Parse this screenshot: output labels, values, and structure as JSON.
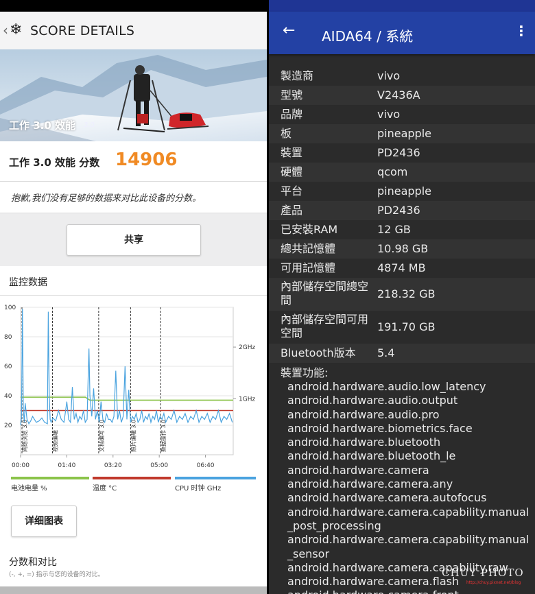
{
  "left": {
    "header": {
      "title": "SCORE DETAILS"
    },
    "hero": {
      "caption": "工作 3.0 效能",
      "version": "3.0"
    },
    "score": {
      "label": "工作 3.0 效能 分数",
      "value": "14906"
    },
    "notice": "抱歉,我们没有足够的数据来对比此设备的分数。",
    "share_label": "共享",
    "monitor": {
      "title": "监控数据",
      "legend": [
        {
          "label": "电池电量 %",
          "color": "#8bc34a"
        },
        {
          "label": "温度 °C",
          "color": "#c0392b"
        },
        {
          "label": "CPU 时钟 GHz",
          "color": "#4aa3df"
        }
      ]
    },
    "detail_label": "详细图表",
    "compare": {
      "title": "分数和对比",
      "subtitle": "(-, +, =) 指示与您的设备的对比。"
    }
  },
  "chart_data": {
    "type": "line",
    "y_left_ticks": [
      "100",
      "80",
      "60",
      "40",
      "20"
    ],
    "y_right_ticks": [
      "2GHz",
      "1GHz"
    ],
    "x_ticks": [
      "00:00",
      "01:40",
      "03:20",
      "05:00",
      "06:40"
    ],
    "sections": [
      "网络浏览 3.0",
      "视频编辑",
      "文档编写 3.0",
      "照片编辑 3.0",
      "数据操作 3.0"
    ],
    "xlim": [
      0,
      460
    ],
    "ylim": [
      0,
      100
    ],
    "series": [
      {
        "name": "电池电量 %",
        "color": "#8bc34a",
        "x": [
          0,
          100,
          140,
          150,
          460
        ],
        "values": [
          39,
          39,
          39,
          37,
          37
        ]
      },
      {
        "name": "温度 °C",
        "color": "#c0392b",
        "x": [
          0,
          460
        ],
        "values": [
          30,
          30
        ]
      },
      {
        "name": "CPU 时钟 GHz",
        "color": "#4aa3df",
        "x": [
          0,
          2,
          4,
          6,
          8,
          10,
          14,
          18,
          22,
          26,
          30,
          34,
          40,
          46,
          52,
          58,
          60,
          62,
          64,
          66,
          70,
          76,
          82,
          88,
          94,
          100,
          104,
          108,
          112,
          116,
          120,
          124,
          128,
          132,
          136,
          140,
          144,
          146,
          148,
          150,
          154,
          158,
          162,
          166,
          170,
          174,
          178,
          182,
          186,
          190,
          194,
          198,
          202,
          206,
          210,
          214,
          218,
          222,
          226,
          230,
          234,
          238,
          242,
          246,
          250,
          254,
          258,
          262,
          266,
          270,
          274,
          278,
          282,
          286,
          290,
          294,
          298,
          302,
          306,
          310,
          314,
          320,
          326,
          332,
          338,
          344,
          350,
          356,
          362,
          368,
          374,
          380,
          386,
          392,
          398,
          404,
          410,
          416,
          422,
          428,
          434,
          440,
          446,
          452,
          458
        ],
        "values": [
          20,
          25,
          99,
          30,
          22,
          35,
          24,
          21,
          23,
          26,
          24,
          22,
          23,
          25,
          22,
          21,
          97,
          40,
          24,
          22,
          25,
          23,
          30,
          24,
          22,
          36,
          24,
          22,
          46,
          24,
          28,
          22,
          26,
          24,
          30,
          22,
          24,
          50,
          72,
          40,
          26,
          45,
          24,
          30,
          22,
          36,
          24,
          22,
          28,
          24,
          24,
          22,
          26,
          57,
          24,
          30,
          22,
          26,
          60,
          24,
          44,
          22,
          26,
          24,
          28,
          22,
          24,
          30,
          22,
          26,
          24,
          28,
          22,
          26,
          24,
          30,
          22,
          26,
          24,
          28,
          22,
          26,
          24,
          30,
          22,
          26,
          24,
          28,
          22,
          26,
          24,
          30,
          22,
          26,
          24,
          28,
          22,
          26,
          24,
          30,
          22,
          26,
          24,
          28,
          22
        ]
      }
    ]
  },
  "right": {
    "title": "AIDA64  /  系統",
    "rows": [
      {
        "key": "製造商",
        "value": "vivo"
      },
      {
        "key": "型號",
        "value": "V2436A"
      },
      {
        "key": "品牌",
        "value": "vivo"
      },
      {
        "key": "板",
        "value": "pineapple"
      },
      {
        "key": "裝置",
        "value": "PD2436"
      },
      {
        "key": "硬體",
        "value": "qcom"
      },
      {
        "key": "平台",
        "value": "pineapple"
      },
      {
        "key": "產品",
        "value": "PD2436"
      },
      {
        "key": "已安裝RAM",
        "value": "12 GB"
      },
      {
        "key": "總共記憶體",
        "value": "10.98 GB"
      },
      {
        "key": "可用記憶體",
        "value": "4874 MB"
      },
      {
        "key": "內部儲存空間總空間",
        "value": "218.32 GB"
      },
      {
        "key": "內部儲存空間可用空間",
        "value": "191.70 GB"
      },
      {
        "key": "Bluetooth版本",
        "value": "5.4"
      }
    ],
    "features_label": "裝置功能:",
    "features": [
      "android.hardware.audio.low_latency",
      "android.hardware.audio.output",
      "android.hardware.audio.pro",
      "android.hardware.biometrics.face",
      "android.hardware.bluetooth",
      "android.hardware.bluetooth_le",
      "android.hardware.camera",
      "android.hardware.camera.any",
      "android.hardware.camera.autofocus",
      "android.hardware.camera.capability.manual_post_processing",
      "android.hardware.camera.capability.manual_sensor",
      "android.hardware.camera.capability.raw",
      "android.hardware.camera.flash",
      "android.hardware.camera.front"
    ],
    "watermark": "CHUY PHOTO",
    "watermark_small": "http://chuy.pixnet.net/blog"
  }
}
